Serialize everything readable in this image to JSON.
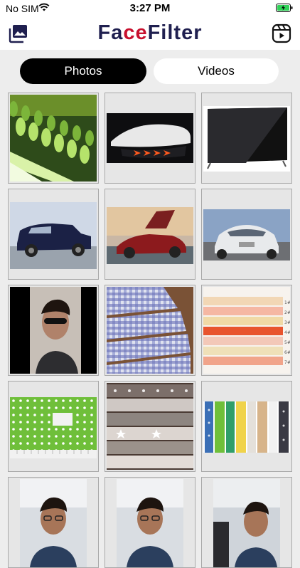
{
  "status_bar": {
    "carrier": "No SIM",
    "time": "3:27 PM",
    "wifi_icon": "wifi-icon",
    "battery_icon": "battery-charging-icon"
  },
  "header": {
    "title_part1": "Fa",
    "title_accent": "ce",
    "title_part2": "Filter",
    "left_icon": "photo-gallery-icon",
    "right_icon": "reels-video-icon"
  },
  "tabs": {
    "photos_label": "Photos",
    "videos_label": "Videos",
    "selected": "Photos"
  },
  "colors": {
    "brand_dark": "#1f1f4f",
    "brand_accent": "#c8102e",
    "selected_tab": "#000000",
    "background": "#ededed"
  },
  "grid": {
    "columns": 3,
    "items": [
      "green glass bottles",
      "white sports car with red tail lights",
      "flat screen television",
      "dark blue SUV",
      "red gullwing sports car",
      "silver luxury sedan",
      "man wearing sunglasses selfie",
      "blue gingham fabric",
      "floral fabric stack",
      "green polka dot fabric",
      "star and dot fabric rolls",
      "colorful printed fabric strips",
      "man with glasses in office",
      "man with glasses in office",
      "man with glasses in office"
    ]
  }
}
